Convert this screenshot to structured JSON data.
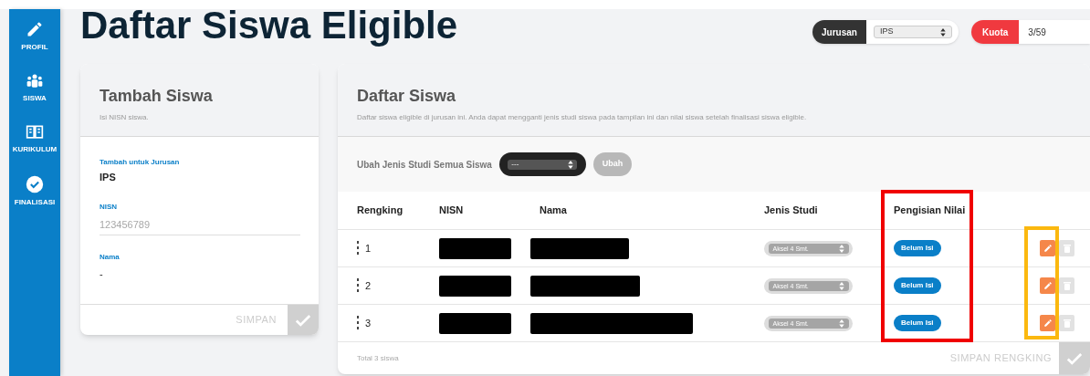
{
  "sidebar": {
    "items": [
      {
        "label": "PROFIL",
        "kind": "pencil"
      },
      {
        "label": "SISWA",
        "kind": "people"
      },
      {
        "label": "KURIKULUM",
        "kind": "book"
      },
      {
        "label": "FINALISASI",
        "kind": "check"
      }
    ]
  },
  "title": "Daftar Siswa Eligible",
  "jurusan": {
    "label": "Jurusan",
    "value": "IPS"
  },
  "kuota": {
    "label": "Kuota",
    "value": "3/59"
  },
  "add_card": {
    "title": "Tambah Siswa",
    "subtitle": "Isi NISN siswa.",
    "jurusan_label": "Tambah untuk Jurusan",
    "jurusan_value": "IPS",
    "nisn_label": "NISN",
    "nisn_placeholder": "123456789",
    "nama_label": "Nama",
    "nama_value": "-",
    "save": "SIMPAN"
  },
  "list_card": {
    "title": "Daftar Siswa",
    "subtitle": "Daftar siswa eligible di jurusan ini. Anda dapat mengganti jenis studi siswa pada tampilan ini dan nilai siswa setelah finalisasi siswa eligible.",
    "bulk_label": "Ubah Jenis Studi Semua Siswa",
    "bulk_value": "---",
    "bulk_button": "Ubah",
    "footer": "Total 3 siswa",
    "save": "SIMPAN RENGKING"
  },
  "table": {
    "columns": [
      "Rengking",
      "NISN",
      "Nama",
      "Jenis Studi",
      "Pengisian Nilai"
    ],
    "rows": [
      {
        "rank": "1",
        "jenis_studi": "Aksel 4 Smt.",
        "status": "Belum Isi"
      },
      {
        "rank": "2",
        "jenis_studi": "Aksel 4 Smt.",
        "status": "Belum Isi"
      },
      {
        "rank": "3",
        "jenis_studi": "Aksel 4 Smt.",
        "status": "Belum Isi"
      }
    ]
  }
}
